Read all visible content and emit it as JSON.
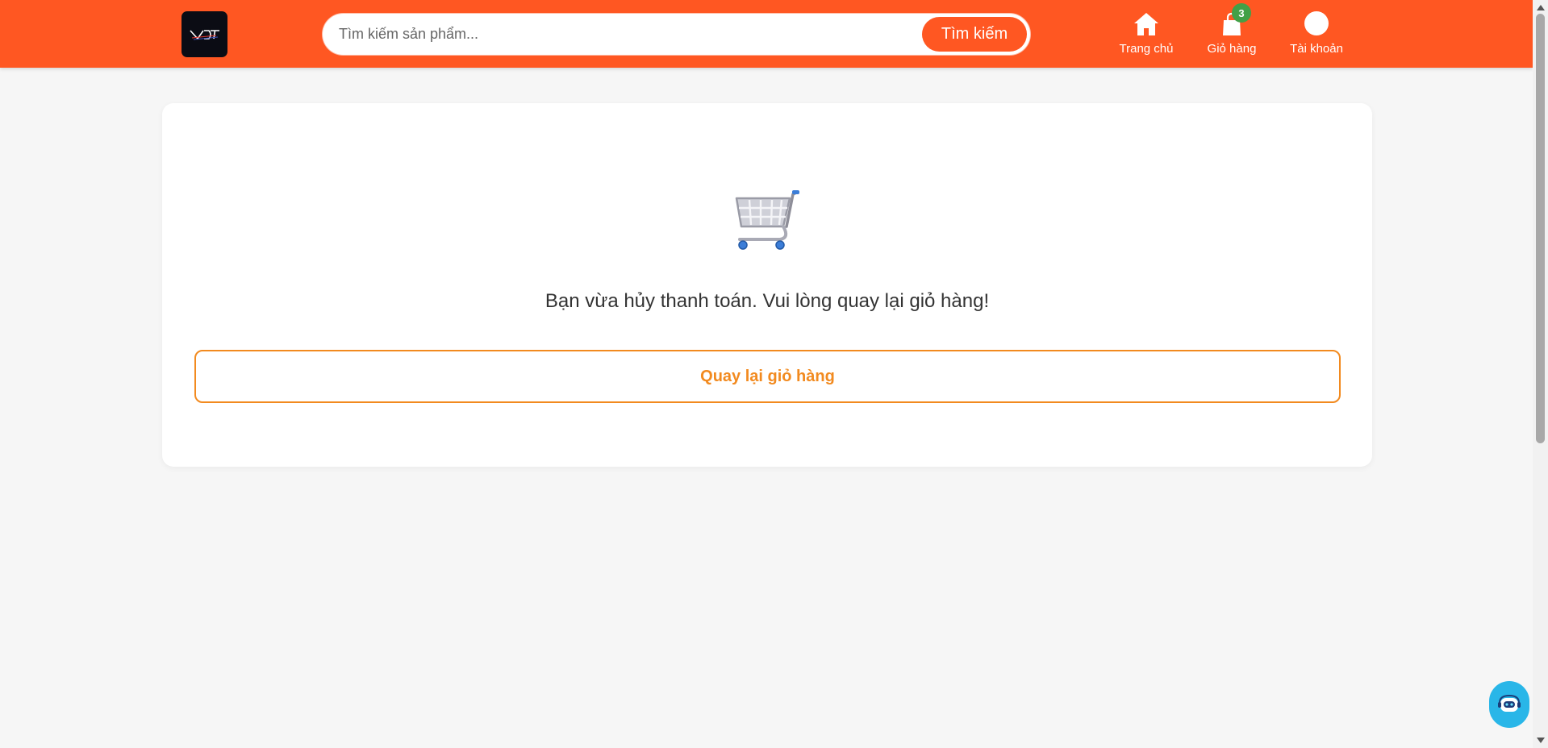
{
  "header": {
    "logo_text": "VDT",
    "search": {
      "placeholder": "Tìm kiếm sản phẩm...",
      "value": "",
      "button_label": "Tìm kiếm"
    },
    "nav": [
      {
        "label": "Trang chủ",
        "icon": "home-icon"
      },
      {
        "label": "Giỏ hàng",
        "icon": "shopping-bag-icon",
        "badge": "3"
      },
      {
        "label": "Tài khoản",
        "icon": "user-icon"
      }
    ]
  },
  "main": {
    "illustration": "shopping-cart-icon",
    "message": "Bạn vừa hủy thanh toán. Vui lòng quay lại giỏ hàng!",
    "back_button_label": "Quay lại giỏ hàng"
  },
  "chat": {
    "icon": "chatbot-icon"
  },
  "colors": {
    "brand": "#ff5722",
    "accent": "#f28a1f",
    "badge": "#43a047",
    "chat": "#29b6e8",
    "background": "#f6f6f6"
  }
}
